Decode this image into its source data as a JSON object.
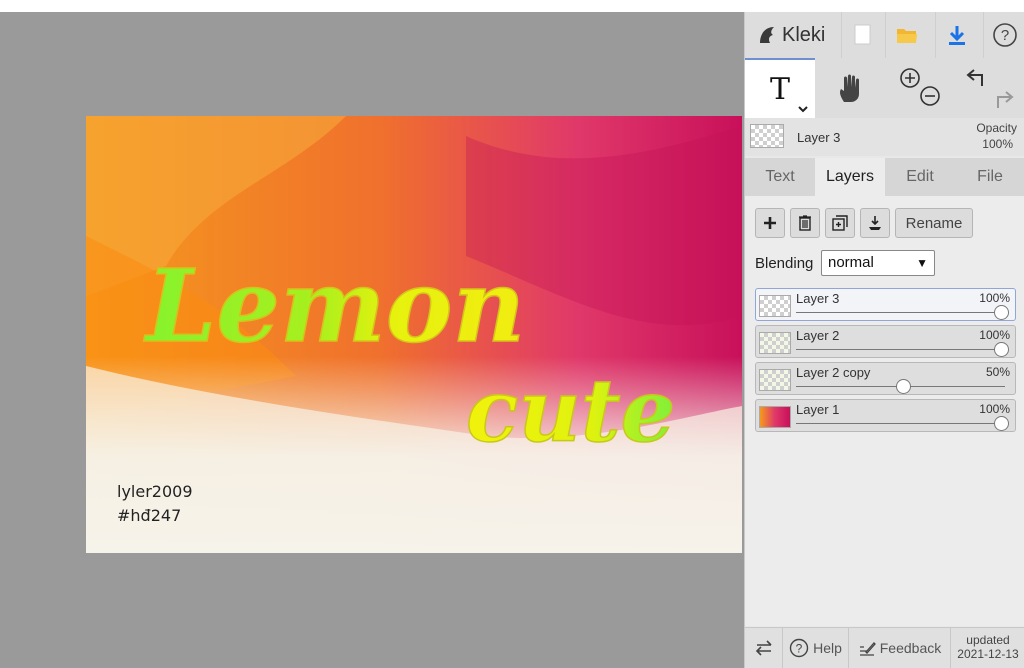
{
  "app": {
    "name": "Kleki"
  },
  "canvas": {
    "lettering": [
      "Lemon",
      "cute"
    ],
    "signature_line1": "lyler2009",
    "signature_line2": "#hđ247"
  },
  "toolbar_icons": {
    "new": "new-file-icon",
    "open": "open-folder-icon",
    "save": "download-icon",
    "help": "help-icon"
  },
  "tools": {
    "text": "T",
    "hand": "hand-icon",
    "zoom": "zoom-icon",
    "undo_redo": "undo-redo-icon"
  },
  "current_layer": {
    "name": "Layer 3",
    "opacity_label": "Opacity",
    "opacity_value": "100%"
  },
  "tabs": [
    {
      "label": "Text",
      "active": false
    },
    {
      "label": "Layers",
      "active": true
    },
    {
      "label": "Edit",
      "active": false
    },
    {
      "label": "File",
      "active": false
    }
  ],
  "layer_actions": {
    "add": "plus-icon",
    "delete": "trash-icon",
    "duplicate": "duplicate-icon",
    "merge": "merge-down-icon",
    "rename_label": "Rename"
  },
  "blending": {
    "label": "Blending",
    "value": "normal"
  },
  "layers": [
    {
      "name": "Layer 3",
      "opacity": "100%",
      "opacity_value": 1.0,
      "active": true
    },
    {
      "name": "Layer 2",
      "opacity": "100%",
      "opacity_value": 1.0,
      "active": false
    },
    {
      "name": "Layer 2 copy",
      "opacity": "50%",
      "opacity_value": 0.5,
      "active": false
    },
    {
      "name": "Layer 1",
      "opacity": "100%",
      "opacity_value": 1.0,
      "active": false
    }
  ],
  "footer": {
    "help_label": "Help",
    "feedback_label": "Feedback",
    "updated_label": "updated",
    "updated_date": "2021-12-13"
  },
  "colors": {
    "accent": "#1a73e8",
    "folder": "#f2b630",
    "lime": "#8cf22a",
    "yellow": "#eef20a"
  }
}
